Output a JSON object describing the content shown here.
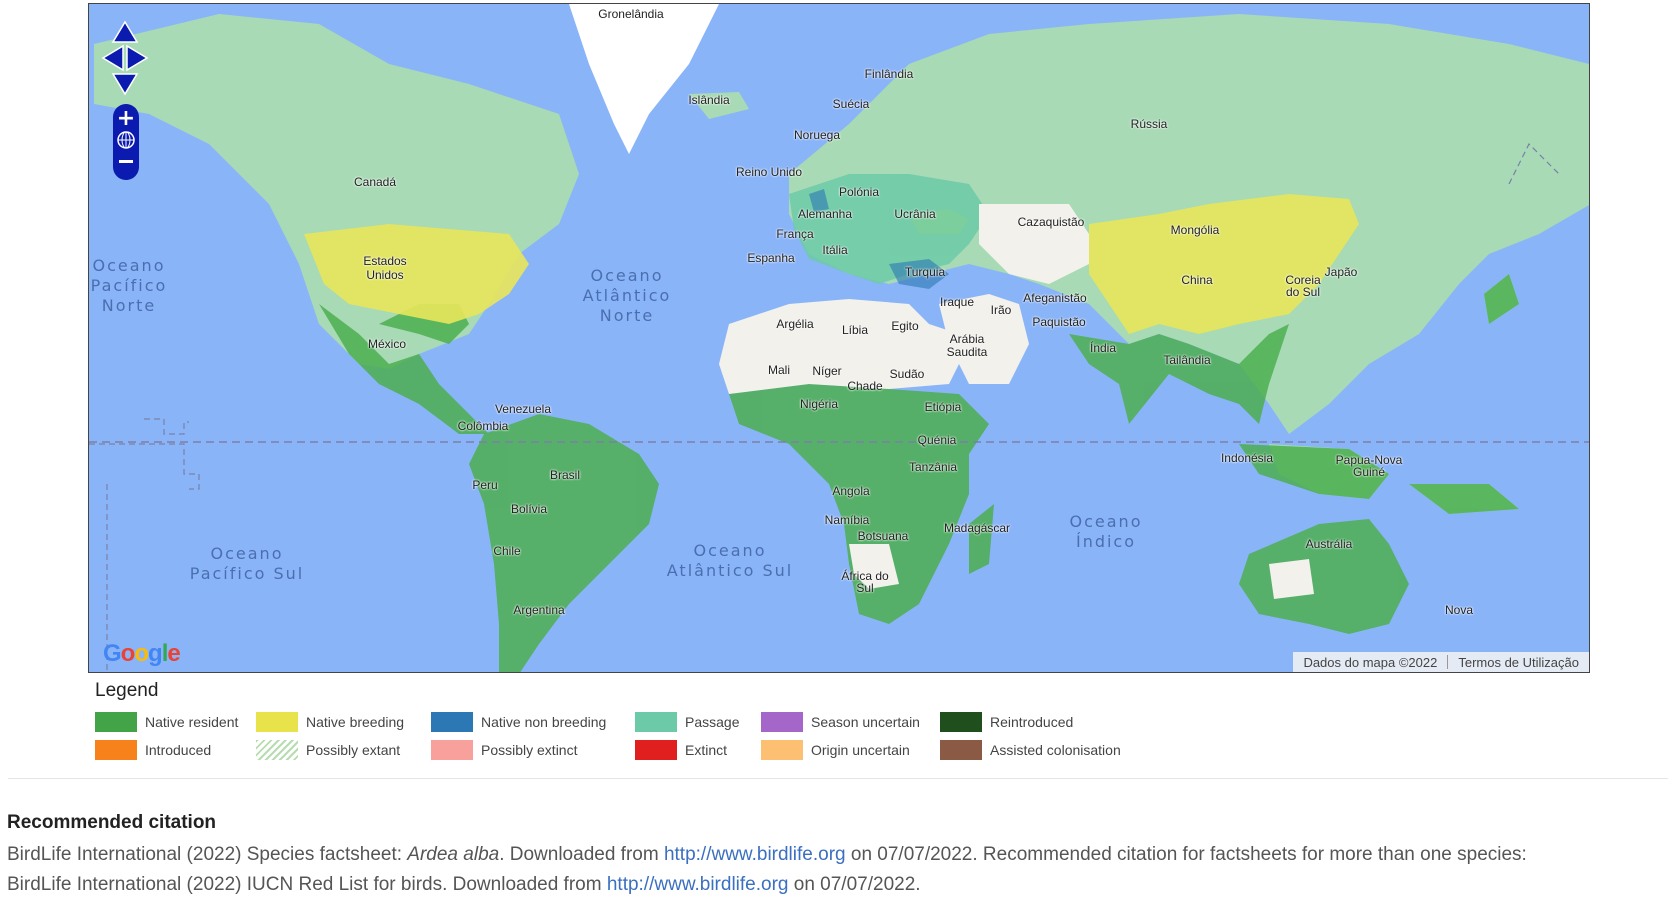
{
  "map": {
    "countries": [
      {
        "id": "groenlandia",
        "label": "Gronelândia"
      },
      {
        "id": "islandia",
        "label": "Islândia"
      },
      {
        "id": "finlandia",
        "label": "Finlândia"
      },
      {
        "id": "suecia",
        "label": "Suécia"
      },
      {
        "id": "noruega",
        "label": "Noruega"
      },
      {
        "id": "russia",
        "label": "Rússia"
      },
      {
        "id": "reino-unido",
        "label": "Reino Unido"
      },
      {
        "id": "polonia",
        "label": "Polónia"
      },
      {
        "id": "alemanha",
        "label": "Alemanha"
      },
      {
        "id": "ucrania",
        "label": "Ucrânia"
      },
      {
        "id": "franca",
        "label": "França"
      },
      {
        "id": "italia",
        "label": "Itália"
      },
      {
        "id": "espanha",
        "label": "Espanha"
      },
      {
        "id": "turquia",
        "label": "Turquia"
      },
      {
        "id": "cazaquistao",
        "label": "Cazaquistão"
      },
      {
        "id": "mongolia",
        "label": "Mongólia"
      },
      {
        "id": "china",
        "label": "China"
      },
      {
        "id": "coreia-do-sul",
        "label": "Coreia do Sul"
      },
      {
        "id": "japao",
        "label": "Japão"
      },
      {
        "id": "canada",
        "label": "Canadá"
      },
      {
        "id": "estados-unidos",
        "label": "Estados Unidos"
      },
      {
        "id": "mexico",
        "label": "México"
      },
      {
        "id": "argelia",
        "label": "Argélia"
      },
      {
        "id": "libia",
        "label": "Líbia"
      },
      {
        "id": "egito",
        "label": "Egito"
      },
      {
        "id": "iraque",
        "label": "Iraque"
      },
      {
        "id": "irao",
        "label": "Irão"
      },
      {
        "id": "afeganistao",
        "label": "Afeganistão"
      },
      {
        "id": "paquistao",
        "label": "Paquistão"
      },
      {
        "id": "arabia-saudita",
        "label": "Arábia Saudita"
      },
      {
        "id": "india",
        "label": "Índia"
      },
      {
        "id": "tailandia",
        "label": "Tailândia"
      },
      {
        "id": "mali",
        "label": "Mali"
      },
      {
        "id": "niger",
        "label": "Níger"
      },
      {
        "id": "chade",
        "label": "Chade"
      },
      {
        "id": "sudao",
        "label": "Sudão"
      },
      {
        "id": "nigeria",
        "label": "Nigéria"
      },
      {
        "id": "etiopia",
        "label": "Etiópia"
      },
      {
        "id": "quenia",
        "label": "Quénia"
      },
      {
        "id": "tanzania",
        "label": "Tanzânia"
      },
      {
        "id": "angola",
        "label": "Angola"
      },
      {
        "id": "namibia",
        "label": "Namíbia"
      },
      {
        "id": "botsuana",
        "label": "Botsuana"
      },
      {
        "id": "africa-do-sul",
        "label": "África do Sul"
      },
      {
        "id": "madagascar",
        "label": "Madagáscar"
      },
      {
        "id": "venezuela",
        "label": "Venezuela"
      },
      {
        "id": "colombia",
        "label": "Colômbia"
      },
      {
        "id": "brasil",
        "label": "Brasil"
      },
      {
        "id": "peru",
        "label": "Peru"
      },
      {
        "id": "bolivia",
        "label": "Bolívia"
      },
      {
        "id": "chile",
        "label": "Chile"
      },
      {
        "id": "argentina",
        "label": "Argentina"
      },
      {
        "id": "indonesia",
        "label": "Indonésia"
      },
      {
        "id": "papua-nova-guine",
        "label": "Papua-Nova Guiné"
      },
      {
        "id": "australia",
        "label": "Austrália"
      },
      {
        "id": "nova-zelandia",
        "label": "Nova"
      }
    ],
    "oceans": [
      {
        "id": "pacifico-norte",
        "label": "Oceano Pacífico Norte"
      },
      {
        "id": "atlantico-norte",
        "label": "Oceano Atlântico Norte"
      },
      {
        "id": "pacifico-sul",
        "label": "Oceano Pacífico Sul"
      },
      {
        "id": "atlantico-sul",
        "label": "Oceano Atlântico Sul"
      },
      {
        "id": "indico",
        "label": "Oceano Índico"
      }
    ],
    "logo": "Google",
    "attribution": "Dados do mapa ©2022",
    "terms_link": "Termos de Utilização",
    "nav_icons": [
      "pan-up-icon",
      "pan-left-icon",
      "pan-right-icon",
      "pan-down-icon",
      "zoom-in-icon",
      "zoom-world-icon",
      "zoom-out-icon"
    ],
    "colors": {
      "ocean": "#8ab4f8",
      "land": "#a8dab5",
      "native_resident": "#4caf50",
      "native_breeding": "#e8e65a",
      "passage": "#6ccaa8",
      "not_present": "#f3f1ec"
    }
  },
  "legend": {
    "title": "Legend",
    "items": [
      {
        "label": "Native resident",
        "color": "#43a347"
      },
      {
        "label": "Native breeding",
        "color": "#e8e34a"
      },
      {
        "label": "Native non breeding",
        "color": "#2b78b4"
      },
      {
        "label": "Passage",
        "color": "#6ccaa8"
      },
      {
        "label": "Season uncertain",
        "color": "#a566c9"
      },
      {
        "label": "Reintroduced",
        "color": "#1e4f1c"
      },
      {
        "label": "Introduced",
        "color": "#f7821b"
      },
      {
        "label": "Possibly extant",
        "color": "hatched-green"
      },
      {
        "label": "Possibly extinct",
        "color": "#f7a09c"
      },
      {
        "label": "Extinct",
        "color": "#e0201e"
      },
      {
        "label": "Origin uncertain",
        "color": "#fdbf72"
      },
      {
        "label": "Assisted colonisation",
        "color": "#8b5a44"
      }
    ]
  },
  "citation": {
    "title": "Recommended citation",
    "line1_prefix": "BirdLife International (2022) Species factsheet: ",
    "species": "Ardea alba",
    "line1_mid": ". Downloaded from ",
    "link1": "http://www.birdlife.org",
    "line1_suffix": " on 07/07/2022. Recommended citation for factsheets for more than one species:",
    "line2_prefix": "BirdLife International (2022) IUCN Red List for birds. Downloaded from ",
    "link2": "http://www.birdlife.org",
    "line2_suffix": " on 07/07/2022."
  }
}
